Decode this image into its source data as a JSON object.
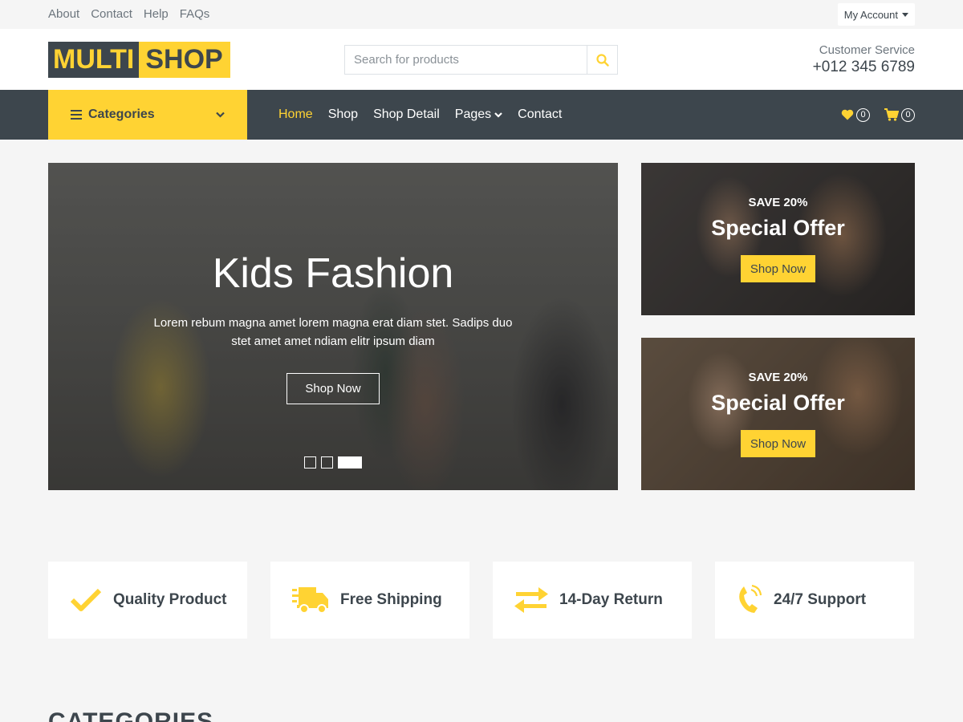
{
  "topbar": {
    "links": [
      "About",
      "Contact",
      "Help",
      "FAQs"
    ],
    "account_label": "My Account"
  },
  "header": {
    "logo_part1": "MULTI",
    "logo_part2": "SHOP",
    "search_placeholder": "Search for products",
    "customer_service_label": "Customer Service",
    "phone": "+012 345 6789"
  },
  "nav": {
    "categories_label": "Categories",
    "items": [
      "Home",
      "Shop",
      "Shop Detail",
      "Pages",
      "Contact"
    ],
    "active_item": "Home",
    "wishlist_count": "0",
    "cart_count": "0"
  },
  "hero": {
    "title": "Kids Fashion",
    "description": "Lorem rebum magna amet lorem magna erat diam stet. Sadips duo stet amet amet ndiam elitr ipsum diam",
    "button_label": "Shop Now",
    "slide_count": 3,
    "active_slide": 3
  },
  "offers": [
    {
      "save": "SAVE 20%",
      "title": "Special Offer",
      "button": "Shop Now"
    },
    {
      "save": "SAVE 20%",
      "title": "Special Offer",
      "button": "Shop Now"
    }
  ],
  "features": [
    {
      "icon": "check-icon",
      "label": "Quality Product"
    },
    {
      "icon": "shipping-truck-icon",
      "label": "Free Shipping"
    },
    {
      "icon": "exchange-arrows-icon",
      "label": "14-Day Return"
    },
    {
      "icon": "phone-volume-icon",
      "label": "24/7 Support"
    }
  ],
  "section": {
    "title": "CATEGORIES"
  },
  "colors": {
    "accent": "#ffd333",
    "dark": "#3d464d",
    "background": "#f5f5f5"
  }
}
